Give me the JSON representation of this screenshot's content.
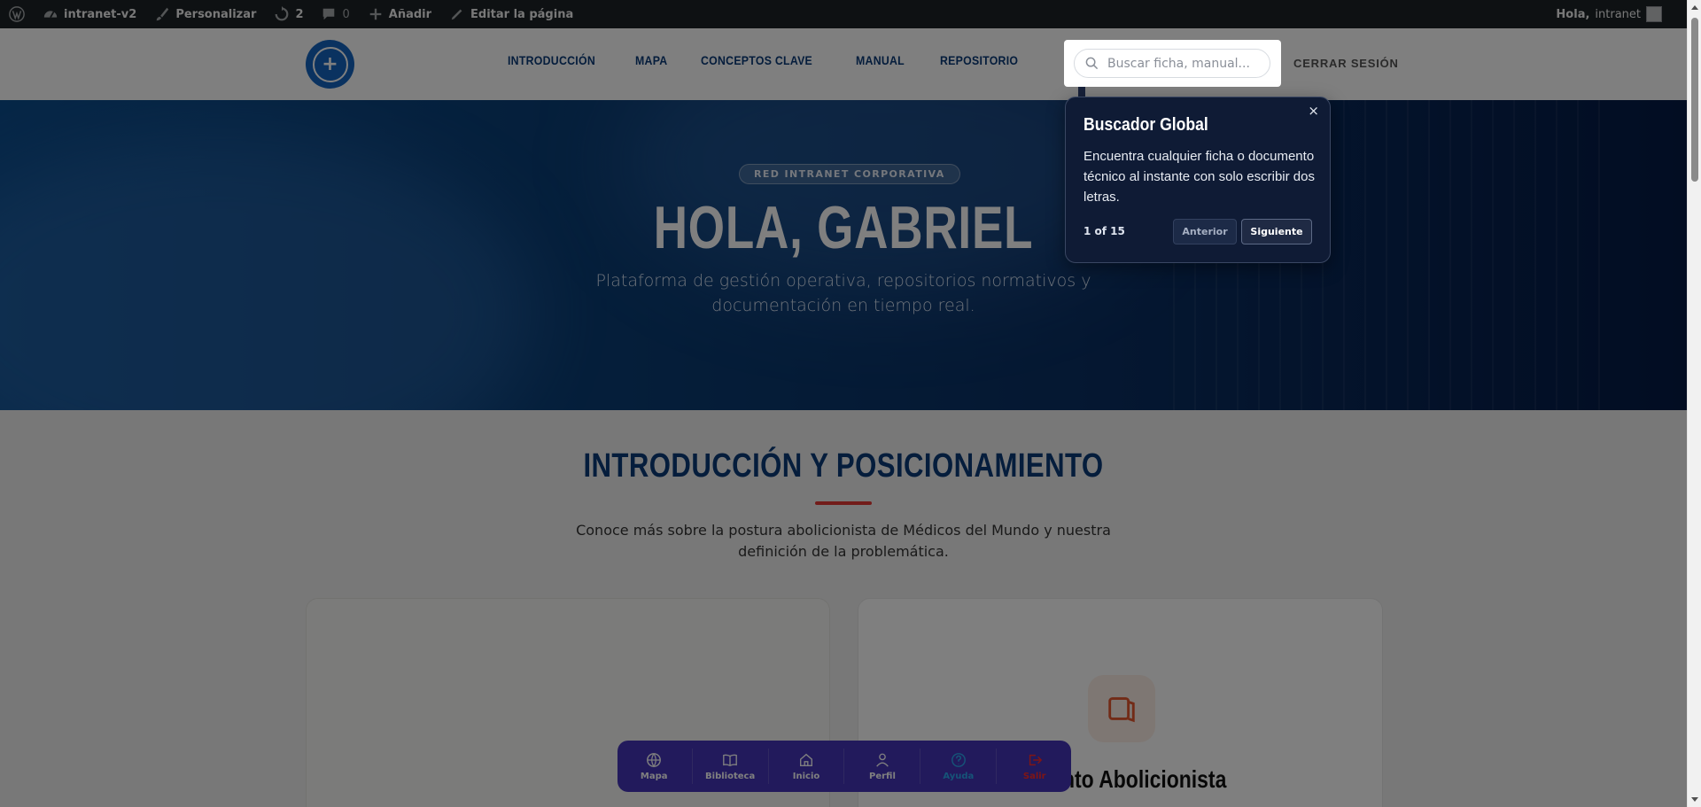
{
  "admin_bar": {
    "site_name": "intranet-v2",
    "customize": "Personalizar",
    "updates_count": "2",
    "comments_count": "0",
    "add_new": "Añadir",
    "edit_page": "Editar la página",
    "greeting_prefix": "Hola,",
    "greeting_user": "intranet"
  },
  "header": {
    "nav": [
      "INTRODUCCIÓN",
      "MAPA",
      "CONCEPTOS CLAVE",
      "MANUAL",
      "REPOSITORIO"
    ],
    "logout": "CERRAR SESIÓN"
  },
  "search": {
    "placeholder": "Buscar ficha, manual..."
  },
  "tour": {
    "title": "Buscador Global",
    "text": "Encuentra cualquier ficha o documento técnico al instante con solo escribir dos letras.",
    "counter": "1 of 15",
    "prev": "Anterior",
    "next": "Siguiente",
    "close": "×"
  },
  "hero": {
    "badge": "RED INTRANET CORPORATIVA",
    "title": "HOLA, GABRIEL",
    "subtitle": "Plataforma de gestión operativa, repositorios normativos y documentación en tiempo real."
  },
  "intro": {
    "title": "INTRODUCCIÓN Y POSICIONAMIENTO",
    "description": "Conoce más sobre la postura abolicionista de Médicos del Mundo y nuestra definición de la problemática.",
    "card_title": "amiento Abolicionista"
  },
  "dock": {
    "items": [
      "Mapa",
      "Biblioteca",
      "Inicio",
      "Perfil",
      "Ayuda",
      "Salir"
    ]
  },
  "colors": {
    "brand_blue": "#0a3a78",
    "accent_red": "#e53935",
    "dock_bg": "#4535b8",
    "popover_bg": "#0f1b35"
  }
}
